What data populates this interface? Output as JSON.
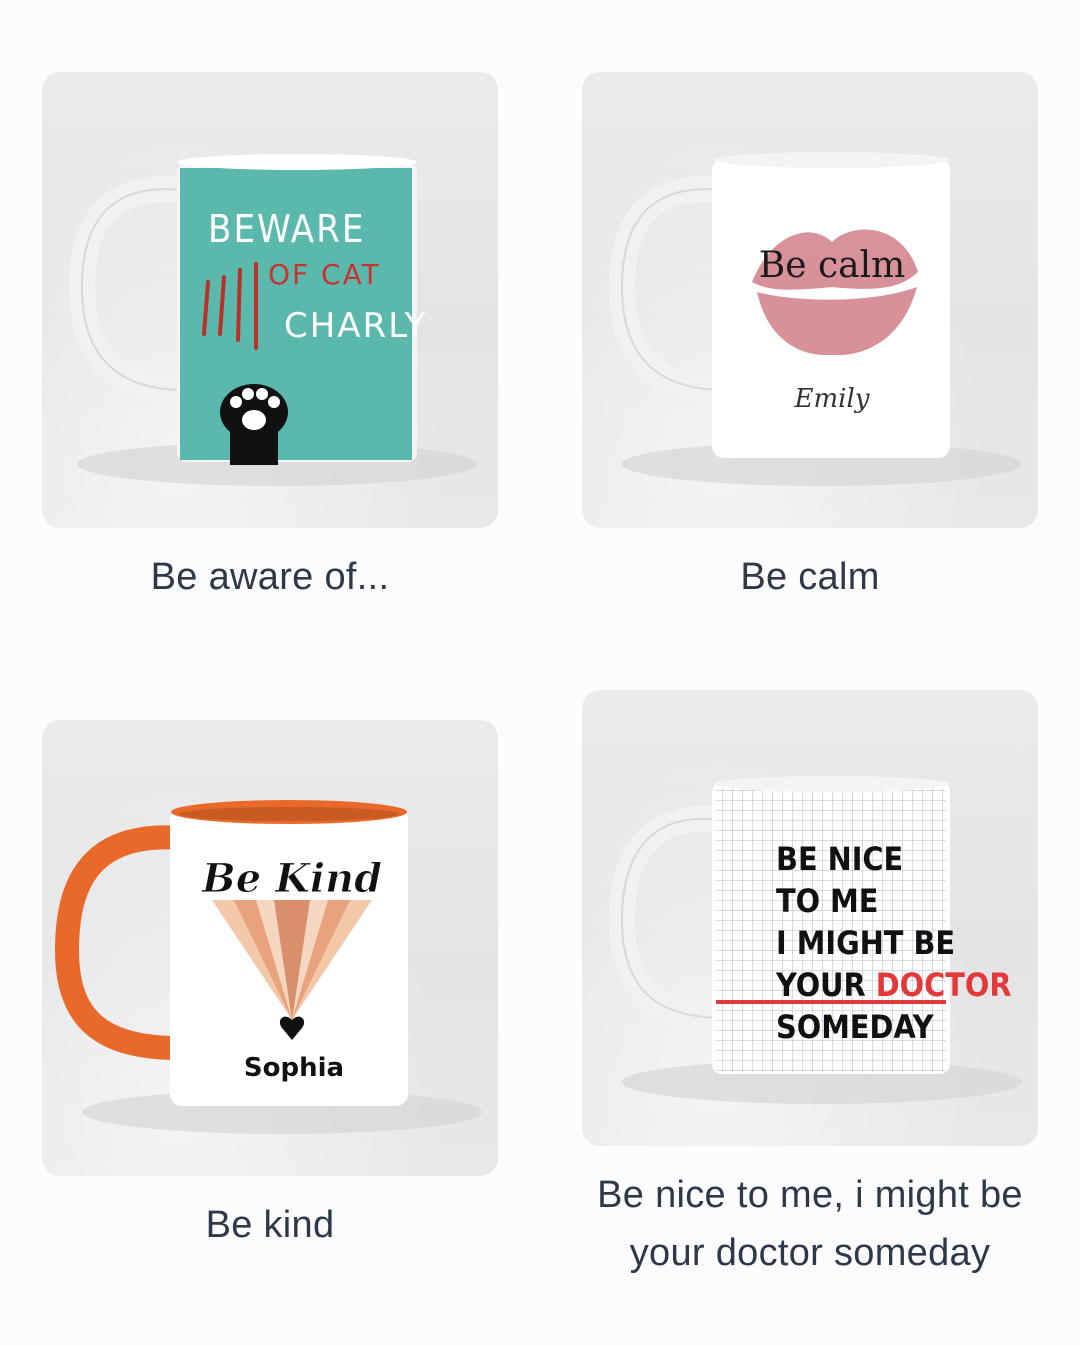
{
  "products": [
    {
      "caption": "Be aware of...",
      "mug_text": {
        "line1": "BEWARE",
        "line2": "OF CAT",
        "line3": "CHARLY"
      },
      "mug_color": "#5bb8ad",
      "icons": [
        "paw-icon",
        "claw-scratch-icon"
      ]
    },
    {
      "caption": "Be calm",
      "mug_text": {
        "headline": "Be calm",
        "name": "Emily"
      },
      "mug_color": "#ffffff",
      "accent": "#d4868f",
      "icons": [
        "lips-kiss-icon"
      ]
    },
    {
      "caption": "Be kind",
      "mug_text": {
        "headline": "Be Kind",
        "name": "Sophia"
      },
      "mug_color": "#ffffff",
      "accent": "#e8692a",
      "icons": [
        "rainbow-beam-icon",
        "heart-icon"
      ]
    },
    {
      "caption": "Be nice to me, i might be your doctor someday",
      "mug_text": {
        "line1": "BE NICE",
        "line2": "TO ME",
        "line3": "I MIGHT BE",
        "line4a": "YOUR ",
        "line4b": "DOCTOR",
        "line5": "SOMEDAY"
      },
      "mug_color": "#ffffff",
      "accent": "#e23a3a",
      "icons": [
        "grid-paper-pattern"
      ]
    }
  ]
}
